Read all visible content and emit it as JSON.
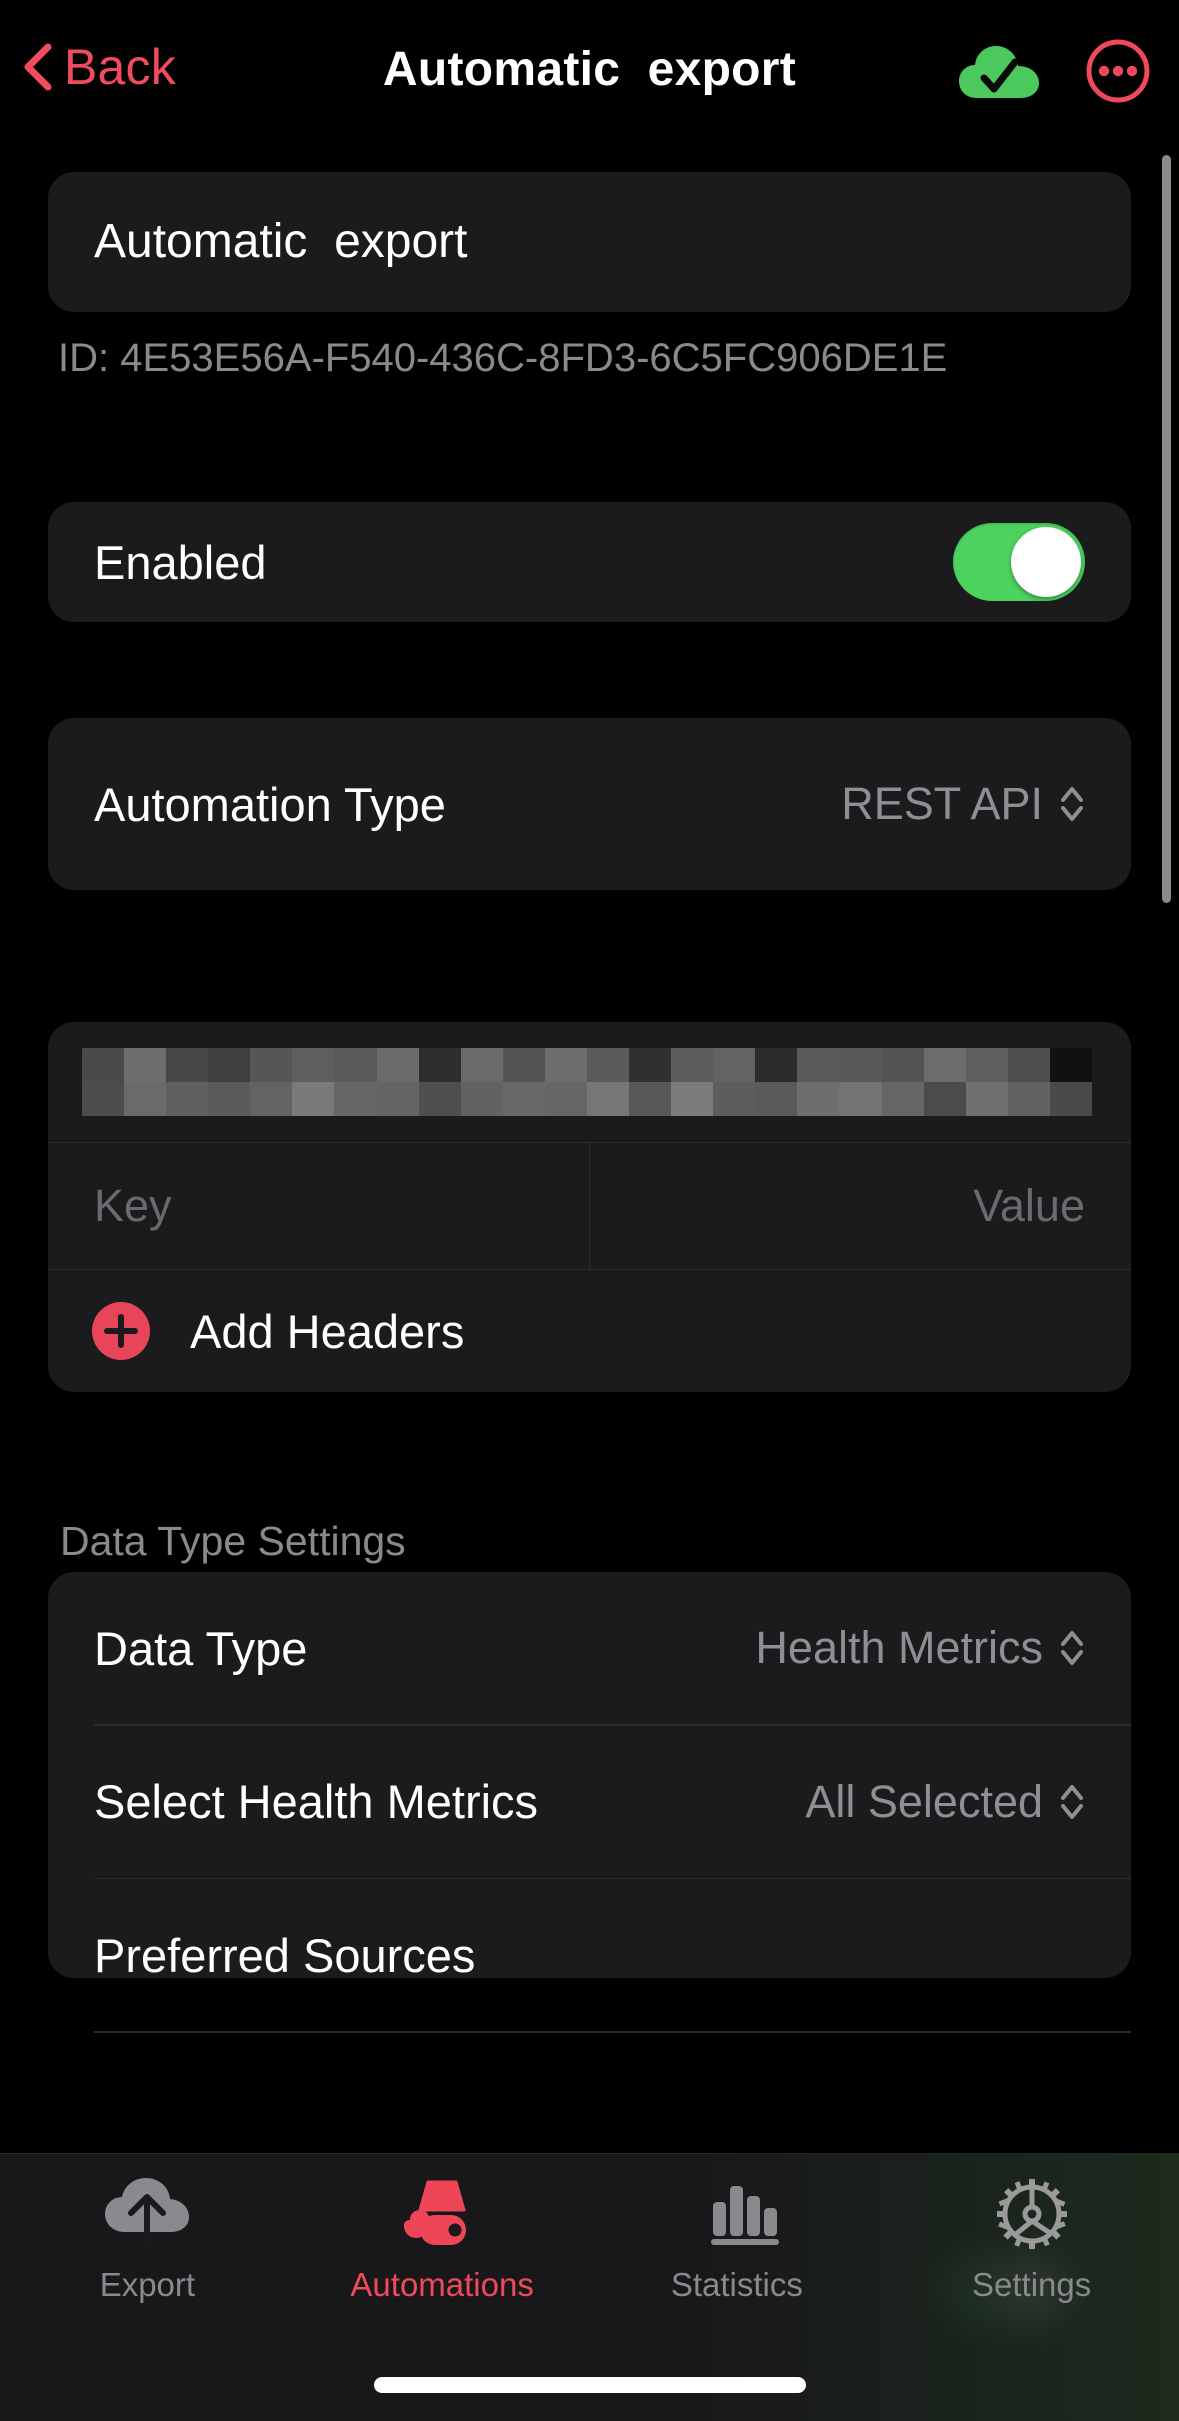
{
  "theme": {
    "background": "#000000",
    "card": "#1B1B1D",
    "accent_red": "#F0495C",
    "accent_green": "#4CD35F",
    "secondary_text": "#8E8E93",
    "divider": "#2C2C2E"
  },
  "navbar": {
    "back_label": "Back",
    "back_icon": "chevron-left-icon",
    "title": "Automatic  export",
    "sync_icon": "cloud-checkmark-icon",
    "more_icon": "ellipsis-circle-icon"
  },
  "automation": {
    "name": "Automatic  export",
    "id_label": "ID: 4E53E56A-F540-436C-8FD3-6C5FC906DE1E",
    "enabled": {
      "label": "Enabled",
      "value": "on"
    },
    "type_row": {
      "label": "Automation Type",
      "value": "REST API",
      "stepper_icon": "chevron-up-down-icon"
    }
  },
  "rest_api": {
    "url_field": {
      "name": "url-field",
      "value": "",
      "redacted": true
    },
    "headers_table": {
      "key_placeholder": "Key",
      "value_placeholder": "Value",
      "key_value": "",
      "value_value": ""
    },
    "add_headers": {
      "label": "Add Headers",
      "icon": "plus-circle-icon"
    }
  },
  "data_type_settings": {
    "section_title": "Data Type Settings",
    "rows": [
      {
        "label": "Data Type",
        "value": "Health Metrics",
        "stepper_icon": "chevron-up-down-icon"
      },
      {
        "label": "Select Health Metrics",
        "value": "All Selected",
        "stepper_icon": "chevron-up-down-icon"
      },
      {
        "label": "Preferred Sources",
        "value": "",
        "stepper_icon": ""
      }
    ]
  },
  "tabbar": {
    "tabs": [
      {
        "label": "Export",
        "icon": "cloud-upload-icon",
        "active": false
      },
      {
        "label": "Automations",
        "icon": "robot-icon",
        "active": true
      },
      {
        "label": "Statistics",
        "icon": "bar-chart-icon",
        "active": false
      },
      {
        "label": "Settings",
        "icon": "gear-icon",
        "active": false
      }
    ]
  },
  "scrollbar": {
    "name": "vertical-scrollbar",
    "position": "top"
  }
}
